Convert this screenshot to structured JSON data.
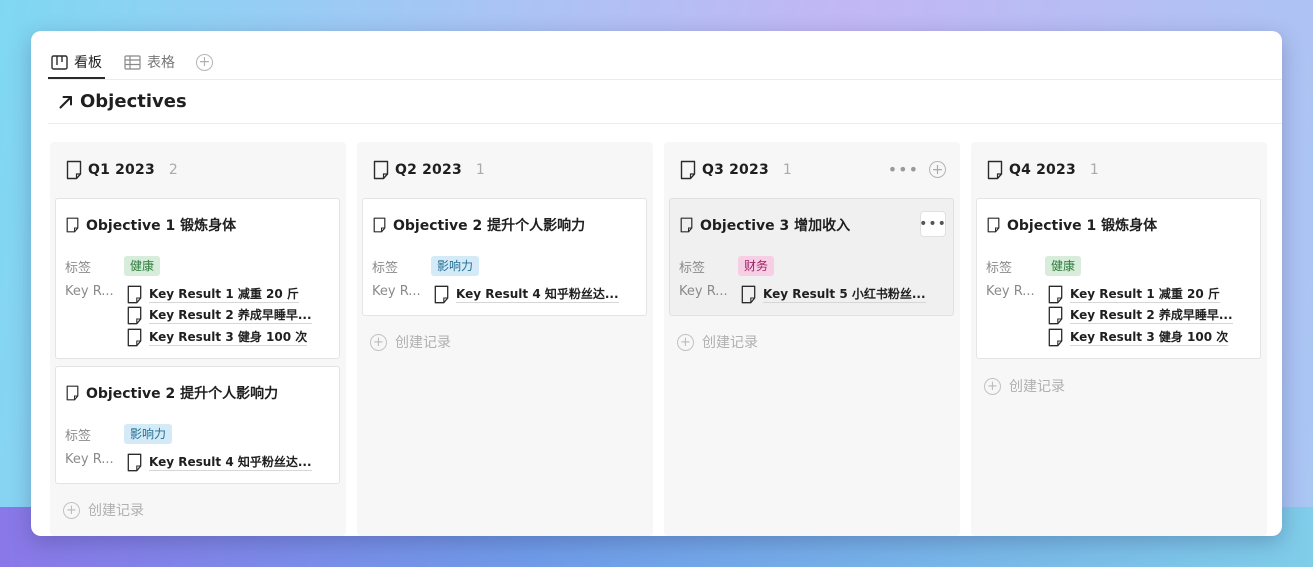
{
  "tabs": [
    {
      "label": "看板",
      "icon": "kanban-icon",
      "active": true
    },
    {
      "label": "表格",
      "icon": "table-icon",
      "active": false
    }
  ],
  "page": {
    "title": "Objectives",
    "icon": "arrow-up-right-icon"
  },
  "labels": {
    "tag_prop": "标签",
    "kr_prop": "Key R...",
    "create_record": "创建记录",
    "more": "•••",
    "add": "+"
  },
  "columns": [
    {
      "title": "Q1 2023",
      "count": "2",
      "cards": [
        {
          "title": "Objective 1 锻炼身体",
          "tag": "健康",
          "tag_color": "#d7ecdb",
          "key_results": [
            "Key Result 1 减重 20 斤",
            "Key Result 2 养成早睡早...",
            "Key Result 3 健身 100 次"
          ]
        },
        {
          "title": "Objective 2 提升个人影响力",
          "tag": "影响力",
          "tag_color": "#d4ebf7",
          "key_results": [
            "Key Result 4 知乎粉丝达..."
          ]
        }
      ]
    },
    {
      "title": "Q2 2023",
      "count": "1",
      "cards": [
        {
          "title": "Objective 2 提升个人影响力",
          "tag": "影响力",
          "tag_color": "#d4ebf7",
          "key_results": [
            "Key Result 4 知乎粉丝达..."
          ]
        }
      ]
    },
    {
      "title": "Q3 2023",
      "count": "1",
      "cards": [
        {
          "title": "Objective 3 增加收入",
          "tag": "财务",
          "tag_color": "#f6cfe4",
          "key_results": [
            "Key Result 5 小红书粉丝..."
          ]
        }
      ]
    },
    {
      "title": "Q4 2023",
      "count": "1",
      "cards": [
        {
          "title": "Objective 1 锻炼身体",
          "tag": "健康",
          "tag_color": "#d7ecdb",
          "key_results": [
            "Key Result 1 减重 20 斤",
            "Key Result 2 养成早睡早...",
            "Key Result 3 健身 100 次"
          ]
        }
      ]
    }
  ]
}
